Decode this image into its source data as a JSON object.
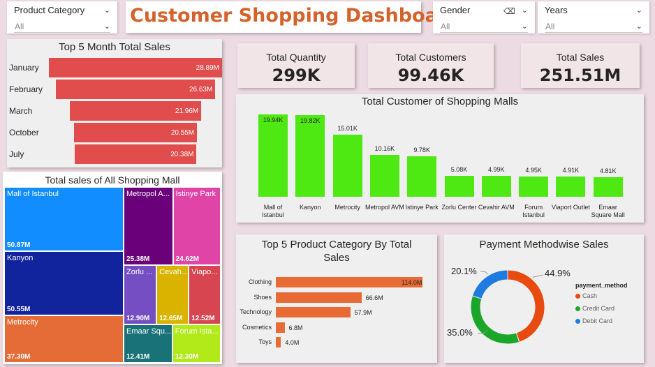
{
  "dashboard": {
    "title": "Customer Shopping Dashboard"
  },
  "slicers": {
    "product_category": {
      "label": "Product Category",
      "value": "All"
    },
    "gender": {
      "label": "Gender",
      "value": "All"
    },
    "years": {
      "label": "Years",
      "value": "All"
    }
  },
  "kpis": {
    "total_quantity": {
      "label": "Total Quantity",
      "value": "299K"
    },
    "total_customers": {
      "label": "Total Customers",
      "value": "99.46K"
    },
    "total_sales": {
      "label": "Total Sales",
      "value": "251.51M"
    }
  },
  "top_months": {
    "title": "Top 5 Month Total Sales",
    "items": [
      {
        "label": "January",
        "display": "28.89M",
        "value": 28.89
      },
      {
        "label": "February",
        "display": "26.63M",
        "value": 26.63
      },
      {
        "label": "March",
        "display": "21.96M",
        "value": 21.96
      },
      {
        "label": "October",
        "display": "20.55M",
        "value": 20.55
      },
      {
        "label": "July",
        "display": "20.38M",
        "value": 20.38
      }
    ],
    "color": "#e14c4c"
  },
  "treemap": {
    "title": "Total sales of All Shopping Mall",
    "items": [
      {
        "name": "Mall of Istanbul",
        "display": "50.87M",
        "value": 50.87,
        "color": "#118dff"
      },
      {
        "name": "Kanyon",
        "display": "50.55M",
        "value": 50.55,
        "color": "#12239e"
      },
      {
        "name": "Metrocity",
        "display": "37.30M",
        "value": 37.3,
        "color": "#e66c37"
      },
      {
        "name": "Metropol A...",
        "display": "25.38M",
        "value": 25.38,
        "color": "#6b007b"
      },
      {
        "name": "Istinye Park",
        "display": "24.62M",
        "value": 24.62,
        "color": "#e044a7"
      },
      {
        "name": "Zorlu ...",
        "display": "12.90M",
        "value": 12.9,
        "color": "#744ec2"
      },
      {
        "name": "Cevah...",
        "display": "12.65M",
        "value": 12.65,
        "color": "#d9b300"
      },
      {
        "name": "Viapo...",
        "display": "12.52M",
        "value": 12.52,
        "color": "#d64550"
      },
      {
        "name": "Emaar Squ...",
        "display": "12.41M",
        "value": 12.41,
        "color": "#197278"
      },
      {
        "name": "Forum Ista...",
        "display": "12.30M",
        "value": 12.3,
        "color": "#b1ea18"
      }
    ]
  },
  "malls_customers": {
    "title": "Total Customer of Shopping Malls",
    "items": [
      {
        "label": "Mall of Istanbul",
        "display": "19.94K",
        "value": 19.94
      },
      {
        "label": "Kanyon",
        "display": "19.82K",
        "value": 19.82
      },
      {
        "label": "Metrocity",
        "display": "15.01K",
        "value": 15.01
      },
      {
        "label": "Metropol AVM",
        "display": "10.16K",
        "value": 10.16
      },
      {
        "label": "Istinye Park",
        "display": "9.78K",
        "value": 9.78
      },
      {
        "label": "Zorlu Center",
        "display": "5.08K",
        "value": 5.08
      },
      {
        "label": "Cevahir AVM",
        "display": "4.99K",
        "value": 4.99
      },
      {
        "label": "Forum Istanbul",
        "display": "4.95K",
        "value": 4.95
      },
      {
        "label": "Viaport Outlet",
        "display": "4.91K",
        "value": 4.91
      },
      {
        "label": "Emaar Square Mall",
        "display": "4.81K",
        "value": 4.81
      }
    ],
    "color": "#4ee812"
  },
  "top_categories": {
    "title_line1": "Top 5 Product Category By Total",
    "title_line2": "Sales",
    "items": [
      {
        "label": "Clothing",
        "display": "114.0M",
        "value": 114.0
      },
      {
        "label": "Shoes",
        "display": "66.6M",
        "value": 66.6
      },
      {
        "label": "Technology",
        "display": "57.9M",
        "value": 57.9
      },
      {
        "label": "Cosmetics",
        "display": "6.8M",
        "value": 6.8
      },
      {
        "label": "Toys",
        "display": "4.0M",
        "value": 4.0
      }
    ],
    "color": "#e86a35"
  },
  "payment": {
    "title": "Payment Methodwise Sales",
    "legend_title": "payment_method",
    "items": [
      {
        "label": "Cash",
        "display": "44.9%",
        "value": 44.9,
        "color": "#e84a10"
      },
      {
        "label": "Credit Card",
        "display": "35.0%",
        "value": 35.0,
        "color": "#1aa628"
      },
      {
        "label": "Debit Card",
        "display": "20.1%",
        "value": 20.1,
        "color": "#1f7be0"
      }
    ]
  },
  "chart_data": [
    {
      "type": "bar",
      "title": "Top 5 Month Total Sales",
      "categories": [
        "January",
        "February",
        "March",
        "October",
        "July"
      ],
      "values": [
        28.89,
        26.63,
        21.96,
        20.55,
        20.38
      ]
    },
    {
      "type": "heatmap",
      "title": "Total sales of All Shopping Mall",
      "categories": [
        "Mall of Istanbul",
        "Kanyon",
        "Metrocity",
        "Metropol A...",
        "Istinye Park",
        "Zorlu ...",
        "Cevah...",
        "Viapo...",
        "Emaar Squ...",
        "Forum Ista..."
      ],
      "values": [
        50.87,
        50.55,
        37.3,
        25.38,
        24.62,
        12.9,
        12.65,
        12.52,
        12.41,
        12.3
      ]
    },
    {
      "type": "bar",
      "title": "Total Customer of Shopping Malls",
      "categories": [
        "Mall of Istanbul",
        "Kanyon",
        "Metrocity",
        "Metropol AVM",
        "Istinye Park",
        "Zorlu Center",
        "Cevahir AVM",
        "Forum Istanbul",
        "Viaport Outlet",
        "Emaar Square Mall"
      ],
      "values": [
        19.94,
        19.82,
        15.01,
        10.16,
        9.78,
        5.08,
        4.99,
        4.95,
        4.91,
        4.81
      ]
    },
    {
      "type": "bar",
      "title": "Top 5 Product Category By Total Sales",
      "categories": [
        "Clothing",
        "Shoes",
        "Technology",
        "Cosmetics",
        "Toys"
      ],
      "values": [
        114.0,
        66.6,
        57.9,
        6.8,
        4.0
      ]
    },
    {
      "type": "pie",
      "title": "Payment Methodwise Sales",
      "categories": [
        "Cash",
        "Credit Card",
        "Debit Card"
      ],
      "values": [
        44.9,
        35.0,
        20.1
      ]
    }
  ]
}
